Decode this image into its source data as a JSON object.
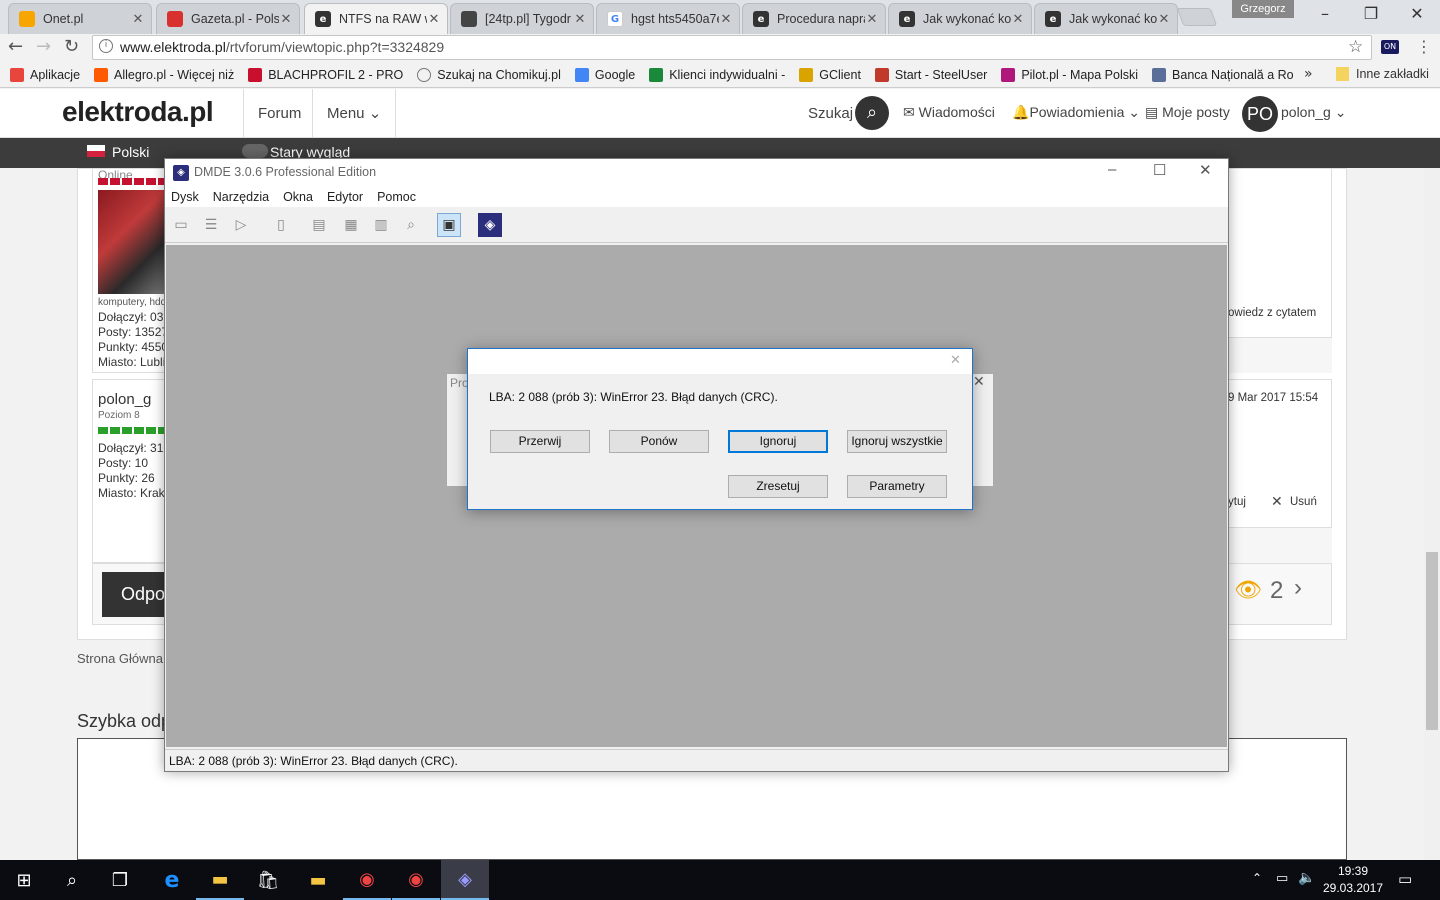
{
  "browser": {
    "profile_name": "Grzegorz",
    "tabs": [
      {
        "title": "Onet.pl",
        "color": "#f7a600"
      },
      {
        "title": "Gazeta.pl - Polsk",
        "color": "#d7302f"
      },
      {
        "title": "NTFS na RAW w",
        "color": "#333333",
        "active": true
      },
      {
        "title": "[24tp.pl] Tygodr",
        "color": "#444444"
      },
      {
        "title": "hgst hts5450a7e",
        "color": "#4285f4"
      },
      {
        "title": "Procedura napra",
        "color": "#333333"
      },
      {
        "title": "Jak wykonać ko",
        "color": "#333333"
      },
      {
        "title": "Jak wykonać ko",
        "color": "#333333"
      }
    ],
    "url_host": "www.elektroda.pl",
    "url_path": "/rtvforum/viewtopic.php?t=3324829",
    "bookmarks": [
      {
        "label": "Aplikacje",
        "color": "#e8453c"
      },
      {
        "label": "Allegro.pl - Więcej niż",
        "color": "#ff5a00"
      },
      {
        "label": "BLACHPROFIL 2 - PRO",
        "color": "#c8102e"
      },
      {
        "label": "Szukaj na Chomikuj.pl",
        "color": "#777777"
      },
      {
        "label": "Google",
        "color": "#4285f4"
      },
      {
        "label": "Klienci indywidualni -",
        "color": "#1a8a3a"
      },
      {
        "label": "GClient",
        "color": "#d9a400"
      },
      {
        "label": "Start - SteelUser",
        "color": "#c0392b"
      },
      {
        "label": "Pilot.pl - Mapa Polski",
        "color": "#b0177a"
      },
      {
        "label": "Banca Națională a Ro",
        "color": "#5a6e9a"
      }
    ],
    "bookmarks_more": "»",
    "other_bookmarks": "Inne zakładki"
  },
  "site": {
    "logo": "elektroda.pl",
    "nav": [
      "Forum",
      "Menu ⌄"
    ],
    "search_label": "Szukaj",
    "messages": "Wiadomości",
    "notifications": "Powiadomienia ⌄",
    "my_posts": "Moje posty",
    "avatar": "PO",
    "username": "polon_g ⌄",
    "language": "Polski",
    "old_look": "Stary wygląd"
  },
  "forum": {
    "post1": {
      "status": "Online",
      "sig": "komputery, hdd",
      "joined": "Dołączył: 03",
      "posts": "Posty: 13527",
      "points": "Punkty: 4550",
      "city": "Miasto: Lubli",
      "reply_quote": "owiedz z cytatem"
    },
    "post2": {
      "username": "polon_g",
      "level": "Poziom 8",
      "joined": "Dołączył: 31",
      "posts": "Posty: 10",
      "points": "Punkty: 26",
      "city": "Miasto: Krak",
      "date": "9 Mar 2017 15:54",
      "edit": "ytuj",
      "delete": "Usuń"
    },
    "reply_button": "Odpo",
    "watchers": "2",
    "breadcrumb": "Strona Główna",
    "quick_reply": "Szybka odp"
  },
  "dmde": {
    "title": "DMDE 3.0.6 Professional Edition",
    "menu": [
      "Dysk",
      "Narzędzia",
      "Okna",
      "Edytor",
      "Pomoc"
    ],
    "status": "LBA: 2 088 (prób 3): WinError 23. Błąd danych (CRC).",
    "back_dialog_title": "Pro"
  },
  "error_dialog": {
    "message": "LBA: 2 088 (prób 3): WinError 23. Błąd danych (CRC).",
    "buttons": {
      "abort": "Przerwij",
      "retry": "Ponów",
      "ignore": "Ignoruj",
      "ignore_all": "Ignoruj wszystkie",
      "reset": "Zresetuj",
      "params": "Parametry"
    }
  },
  "taskbar": {
    "time": "19:39",
    "date": "29.03.2017"
  }
}
